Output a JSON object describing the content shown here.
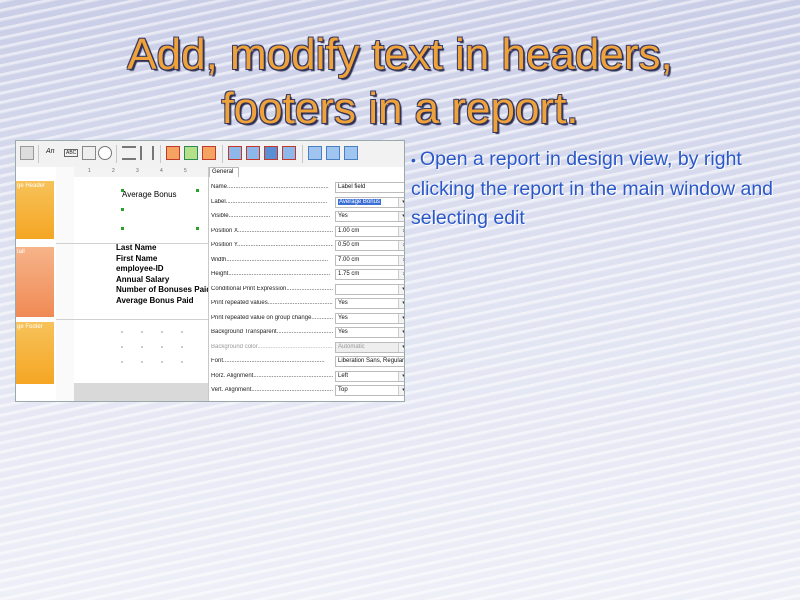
{
  "slide": {
    "title_line1": "Add, modify text in headers,",
    "title_line2": "footers in a report.",
    "bullet": "Open a report in design view, by right clicking the report in the main window and selecting edit"
  },
  "report_designer": {
    "toolbar": {
      "text_label": "An",
      "label_label": "ABC"
    },
    "ruler_marks": [
      "1",
      "2",
      "3",
      "4",
      "5",
      "6"
    ],
    "sections": [
      "ge Header",
      "tail",
      "ge Footer"
    ],
    "header_field": "Average Bonus",
    "detail_fields": [
      "Last Name",
      "First Name",
      "employee-ID",
      "Annual Salary",
      "Number of Bonuses Paid",
      "Average Bonus Paid"
    ],
    "property_tab": "General",
    "properties": [
      {
        "name": "Name",
        "value": "Label field"
      },
      {
        "name": "Label",
        "value": "Average Bonus",
        "selected": true,
        "control": "dropdown"
      },
      {
        "name": "Visible",
        "value": "Yes",
        "control": "dropdown"
      },
      {
        "name": "Position X",
        "value": "1.00 cm",
        "control": "spin"
      },
      {
        "name": "Position Y",
        "value": "0.50 cm",
        "control": "spin"
      },
      {
        "name": "Width",
        "value": "7.00 cm",
        "control": "spin"
      },
      {
        "name": "Height",
        "value": "1.75 cm",
        "control": "spin"
      },
      {
        "name": "Conditional Print Expression",
        "value": "",
        "control": "dropdown"
      },
      {
        "name": "Print repeated values",
        "value": "Yes",
        "control": "dropdown"
      },
      {
        "name": "Print repeated value on group change",
        "value": "Yes",
        "control": "dropdown"
      },
      {
        "name": "Background Transparent",
        "value": "Yes",
        "control": "dropdown"
      },
      {
        "name": "Background color",
        "value": "Automatic",
        "disabled": true,
        "control": "dropdown"
      },
      {
        "name": "Font",
        "value": "Liberation Sans, Regular"
      },
      {
        "name": "Horz. Alignment",
        "value": "Left",
        "control": "dropdown"
      },
      {
        "name": "Vert. Alignment",
        "value": "Top",
        "control": "dropdown"
      }
    ]
  },
  "colors": {
    "title": "#f0a23a",
    "bullet_text": "#2a58c8",
    "section_header": "#f5a623",
    "selection": "#3b6fd6"
  }
}
